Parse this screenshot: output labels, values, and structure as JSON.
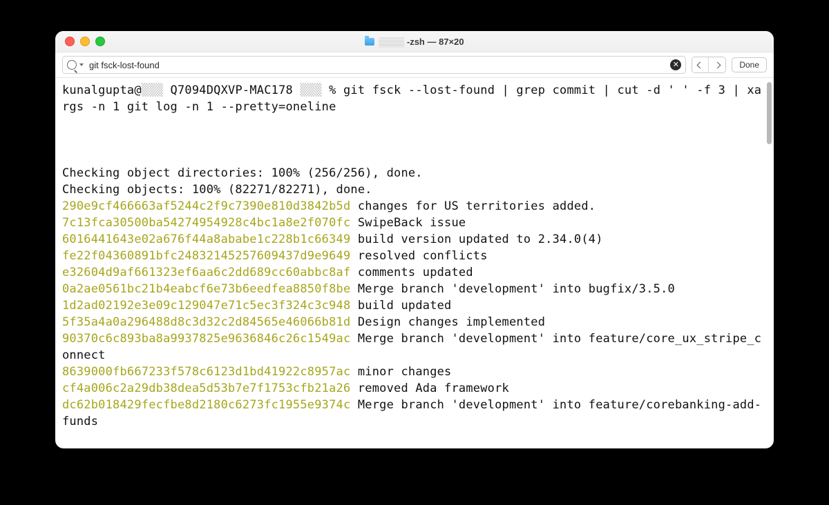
{
  "window": {
    "title": "-zsh — 87×20",
    "title_obscured_prefix": "…"
  },
  "toolbar": {
    "search_value": "git fsck-lost-found",
    "done_label": "Done"
  },
  "terminal": {
    "prompt_user": "kunalgupta@",
    "prompt_host_obscured": "… ",
    "prompt_machine": "Q7094DQXVP-MAC178",
    "prompt_dir_obscured": " … ",
    "prompt_symbol": "%",
    "command": "git fsck --lost-found | grep commit | cut -d ' ' -f 3 | xargs -n 1 git log -n 1 --pretty=oneline",
    "progress": [
      "Checking object directories: 100% (256/256), done.",
      "Checking objects: 100% (82271/82271), done."
    ],
    "commits": [
      {
        "hash": "290e9cf466663af5244c2f9c7390e810d3842b5d",
        "msg": "changes for US territories added."
      },
      {
        "hash": "7c13fca30500ba54274954928c4bc1a8e2f070fc",
        "msg": "SwipeBack issue"
      },
      {
        "hash": "6016441643e02a676f44a8ababe1c228b1c66349",
        "msg": "build version updated to 2.34.0(4)"
      },
      {
        "hash": "fe22f04360891bfc24832145257609437d9e9649",
        "msg": "resolved conflicts"
      },
      {
        "hash": "e32604d9af661323ef6aa6c2dd689cc60abbc8af",
        "msg": "comments updated"
      },
      {
        "hash": "0a2ae0561bc21b4eabcf6e73b6eedfea8850f8be",
        "msg": "Merge branch 'development' into bugfix/3.5.0"
      },
      {
        "hash": "1d2ad02192e3e09c129047e71c5ec3f324c3c948",
        "msg": "build updated"
      },
      {
        "hash": "5f35a4a0a296488d8c3d32c2d84565e46066b81d",
        "msg": "Design changes implemented"
      },
      {
        "hash": "90370c6c893ba8a9937825e9636846c26c1549ac",
        "msg": "Merge branch 'development' into feature/core_ux_stripe_connect"
      },
      {
        "hash": "8639000fb667233f578c6123d1bd41922c8957ac",
        "msg": "minor changes"
      },
      {
        "hash": "cf4a006c2a29db38dea5d53b7e7f1753cfb21a26",
        "msg": "removed Ada framework"
      },
      {
        "hash": "dc62b018429fecfbe8d2180c6273fc1955e9374c",
        "msg": "Merge branch 'development' into feature/corebanking-add-funds"
      }
    ]
  }
}
